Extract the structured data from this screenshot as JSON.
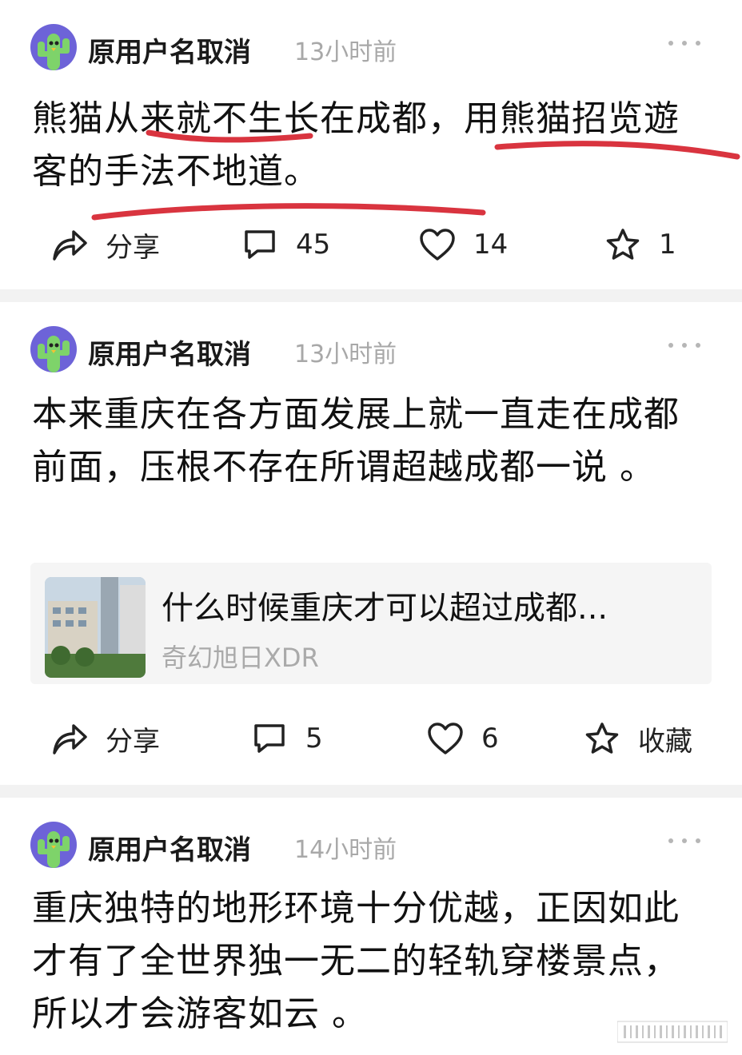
{
  "posts": [
    {
      "username": "原用户名取消",
      "time": "13小时前",
      "text": "熊猫从来就不生长在成都，用熊猫招览遊客的手法不地道。",
      "actions": {
        "share": "分享",
        "comments": "45",
        "likes": "14",
        "favorites": "1"
      }
    },
    {
      "username": "原用户名取消",
      "time": "13小时前",
      "text": "本来重庆在各方面发展上就一直走在成都前面，压根不存在所谓超越成都一说 。",
      "link": {
        "title": "什么时候重庆才可以超过成都...",
        "author": "奇幻旭日XDR"
      },
      "actions": {
        "share": "分享",
        "comments": "5",
        "likes": "6",
        "favorites": "收藏"
      }
    },
    {
      "username": "原用户名取消",
      "time": "14小时前",
      "text": "重庆独特的地形环境十分优越，正因如此才有了全世界独一无二的轻轨穿楼景点，所以才会游客如云 。"
    }
  ],
  "colors": {
    "annotation": "#d9343f",
    "avatar_bg": "#6d63d8",
    "cactus": "#7ed36a"
  },
  "icons": [
    "avatar-cactus-icon",
    "more-dots-icon",
    "share-icon",
    "comment-icon",
    "heart-icon",
    "star-icon"
  ]
}
